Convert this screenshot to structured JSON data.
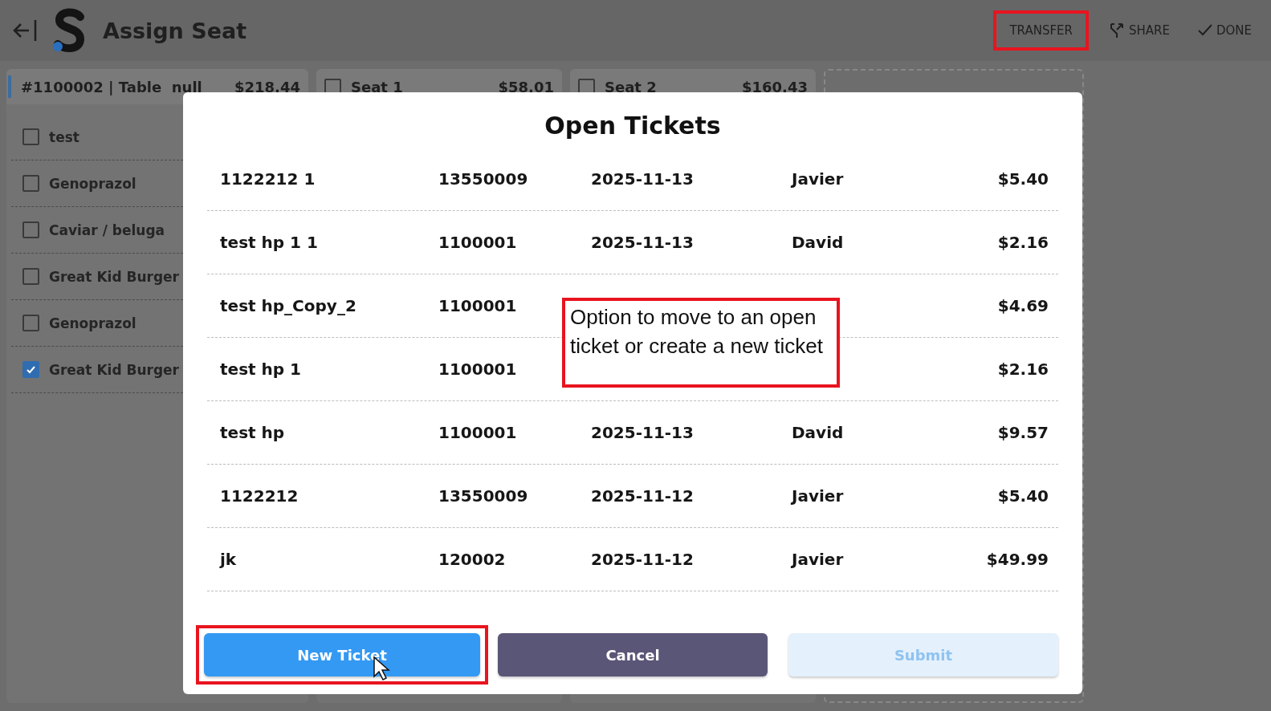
{
  "header": {
    "title": "Assign Seat",
    "actions": [
      {
        "kind": "text",
        "label": "TRANSFER",
        "highlighted": true
      },
      {
        "kind": "share",
        "label": "SHARE",
        "highlighted": false
      },
      {
        "kind": "done",
        "label": "DONE",
        "highlighted": false
      }
    ]
  },
  "order_card": {
    "title": "#1100002 | Table  null",
    "total": "$218.44",
    "items": [
      {
        "label": "test",
        "checked": false
      },
      {
        "label": "Genoprazol",
        "checked": false
      },
      {
        "label": "Caviar / beluga",
        "checked": false
      },
      {
        "label": "Great Kid Burger",
        "checked": false
      },
      {
        "label": "Genoprazol",
        "checked": false
      },
      {
        "label": "Great Kid Burger",
        "checked": true
      }
    ]
  },
  "seats": [
    {
      "label": "Seat 1",
      "total": "$58.01",
      "checked": false
    },
    {
      "label": "Seat 2",
      "total": "$160.43",
      "checked": false
    }
  ],
  "dialog": {
    "title": "Open Tickets",
    "rows": [
      {
        "name": "1122212 1",
        "number": "13550009",
        "date": "2025-11-13",
        "server": "Javier",
        "amount": "$5.40"
      },
      {
        "name": "test hp 1 1",
        "number": "1100001",
        "date": "2025-11-13",
        "server": "David",
        "amount": "$2.16"
      },
      {
        "name": "test hp_Copy_2",
        "number": "1100001",
        "amount": "$4.69"
      },
      {
        "name": "test hp 1",
        "number": "1100001",
        "amount": "$2.16"
      },
      {
        "name": "test hp",
        "number": "1100001",
        "date": "2025-11-13",
        "server": "David",
        "amount": "$9.57"
      },
      {
        "name": "1122212",
        "number": "13550009",
        "date": "2025-11-12",
        "server": "Javier",
        "amount": "$5.40"
      },
      {
        "name": "jk",
        "number": "120002",
        "date": "2025-11-12",
        "server": "Javier",
        "amount": "$49.99"
      }
    ],
    "callout": "Option to move to an open ticket or create a new ticket",
    "buttons": [
      {
        "kind": "primary",
        "label": "New Ticket",
        "disabled": false,
        "highlighted": true
      },
      {
        "kind": "secondary",
        "label": "Cancel",
        "disabled": false,
        "highlighted": false
      },
      {
        "kind": "primary",
        "label": "Submit",
        "disabled": true,
        "highlighted": false
      }
    ]
  }
}
